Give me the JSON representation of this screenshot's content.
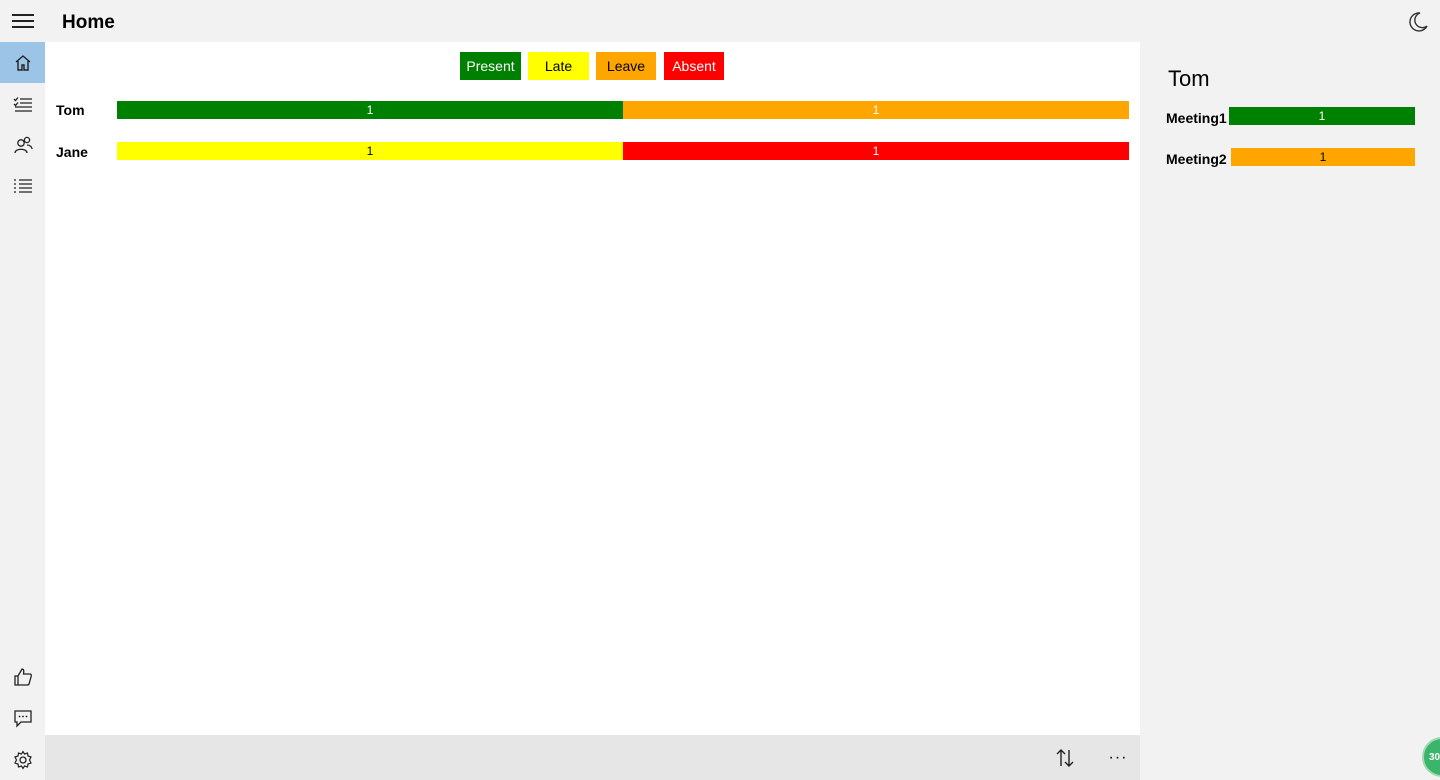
{
  "header": {
    "title": "Home"
  },
  "legend": [
    {
      "label": "Present",
      "color": "#008000",
      "text_color": "#ffffff"
    },
    {
      "label": "Late",
      "color": "#ffff00",
      "text_color": "#000000"
    },
    {
      "label": "Leave",
      "color": "#ffa500",
      "text_color": "#000000"
    },
    {
      "label": "Absent",
      "color": "#ff0000",
      "text_color": "#ffffff"
    }
  ],
  "rows": [
    {
      "name": "Tom",
      "segments": [
        {
          "status": "Present",
          "value": "1",
          "color": "#008000",
          "text_color": "#ffffff"
        },
        {
          "status": "Leave",
          "value": "1",
          "color": "#ffa500",
          "text_color": "#ffffff"
        }
      ]
    },
    {
      "name": "Jane",
      "segments": [
        {
          "status": "Late",
          "value": "1",
          "color": "#ffff00",
          "text_color": "#000000"
        },
        {
          "status": "Absent",
          "value": "1",
          "color": "#ff0000",
          "text_color": "#ffffff"
        }
      ]
    }
  ],
  "detail": {
    "title": "Tom",
    "meetings": [
      {
        "name": "Meeting1",
        "value": "1",
        "color": "#008000",
        "text_color": "#ffffff"
      },
      {
        "name": "Meeting2",
        "value": "1",
        "color": "#ffa500",
        "text_color": "#000000"
      }
    ]
  },
  "nav_top": [
    "home-icon",
    "checklist-icon",
    "people-icon",
    "list-icon"
  ],
  "nav_bottom": [
    "thumbs-up-icon",
    "feedback-icon",
    "settings-icon"
  ],
  "appbar": {
    "sort_icon": "sort-icon",
    "more_label": "···"
  },
  "badge": {
    "label": "30"
  }
}
